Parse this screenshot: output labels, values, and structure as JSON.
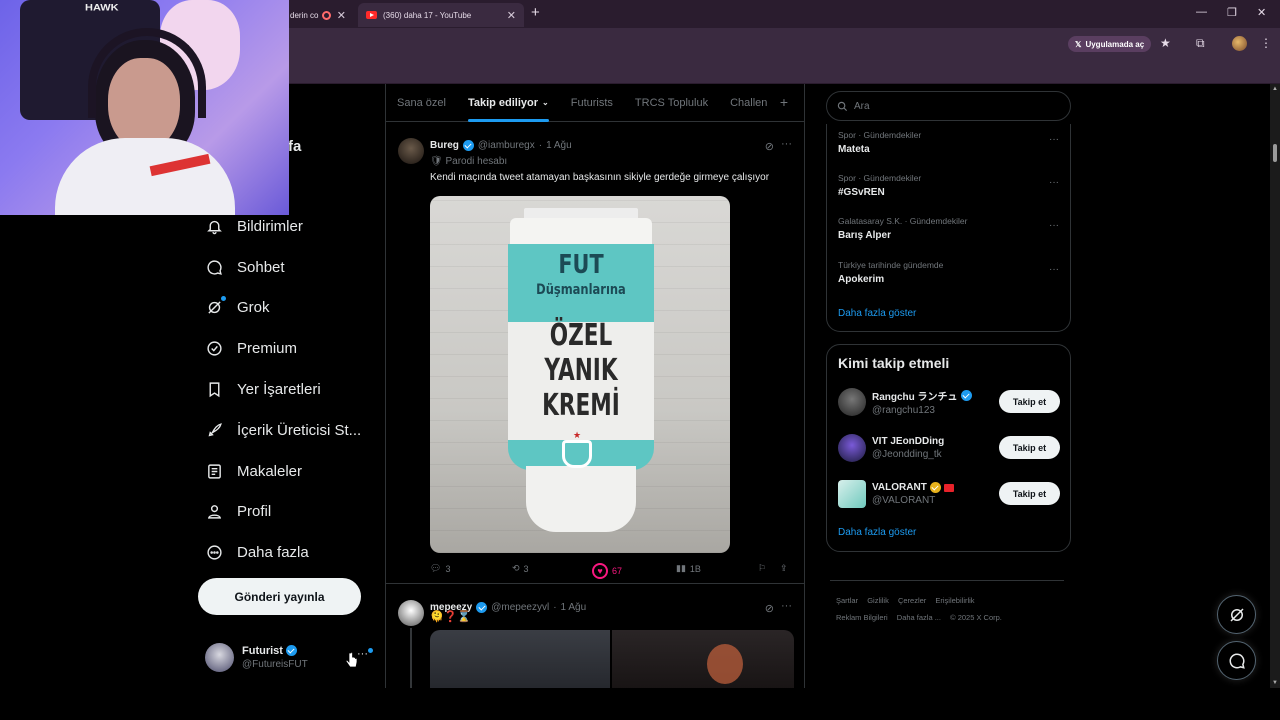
{
  "browser": {
    "tabs": [
      {
        "title": "derin co"
      },
      {
        "title": "(360) daha 17 - YouTube"
      }
    ],
    "open_in_app": "Uygulamada aç"
  },
  "webcam": {
    "chair_label": "HAWK"
  },
  "sidebar": {
    "partial_label": "fa",
    "items": [
      {
        "label": "Bildirimler",
        "icon": "bell-icon"
      },
      {
        "label": "Sohbet",
        "icon": "chat-icon"
      },
      {
        "label": "Grok",
        "icon": "grok-icon"
      },
      {
        "label": "Premium",
        "icon": "verified-circle-icon"
      },
      {
        "label": "Yer İşaretleri",
        "icon": "bookmark-icon"
      },
      {
        "label": "İçerik Üreticisi St...",
        "icon": "rocket-icon"
      },
      {
        "label": "Makaleler",
        "icon": "article-icon"
      },
      {
        "label": "Profil",
        "icon": "person-icon"
      },
      {
        "label": "Daha fazla",
        "icon": "more-circle-icon"
      }
    ],
    "post_button": "Gönderi yayınla",
    "account": {
      "name": "Futurist",
      "handle": "@FutureisFUT"
    }
  },
  "timeline": {
    "tabs": [
      {
        "label": "Sana özel"
      },
      {
        "label": "Takip ediliyor"
      },
      {
        "label": "Futurists"
      },
      {
        "label": "TRCS Topluluk"
      },
      {
        "label": "Challen"
      }
    ],
    "tweets": [
      {
        "name": "Bureg",
        "handle": "@iamburegx",
        "date": "1 Ağu",
        "parody": "Parodi hesabı",
        "text": "Kendi maçında tweet atamayan başkasının sikiyle gerdeğe girmeye çalışıyor",
        "media": {
          "line1": "FUT",
          "line2": "Düşmanlarına",
          "line3": "ÖZEL",
          "line4": "YANIK",
          "line5": "KREMİ"
        },
        "replies": "3",
        "reposts": "3",
        "likes": "67",
        "views": "1B"
      },
      {
        "name": "mepeezy",
        "handle": "@mepeezyvl",
        "date": "1 Ağu",
        "text": "🫠❓⌛"
      }
    ]
  },
  "right": {
    "search_placeholder": "Ara",
    "trends": [
      {
        "context": "Spor · Gündemdekiler",
        "name": "Mateta"
      },
      {
        "context": "Spor · Gündemdekiler",
        "name": "#GSvREN"
      },
      {
        "context": "Galatasaray S.K. · Gündemdekiler",
        "name": "Barış Alper"
      },
      {
        "context": "Türkiye tarihinde gündemde",
        "name": "Apokerim"
      }
    ],
    "show_more": "Daha fazla göster",
    "who_to_follow": {
      "title": "Kimi takip etmeli",
      "users": [
        {
          "name": "Rangchu ランチュ",
          "handle": "@rangchu123",
          "button": "Takip et"
        },
        {
          "name": "VIT JEonDDing",
          "handle": "@Jeondding_tk",
          "button": "Takip et"
        },
        {
          "name": "VALORANT",
          "handle": "@VALORANT",
          "button": "Takip et"
        }
      ],
      "show_more": "Daha fazla göster"
    },
    "footer": {
      "links": [
        "Şartlar",
        "Gizlilik",
        "Çerezler",
        "Erişilebilirlik",
        "Reklam Bilgileri",
        "Daha fazla ...",
        "© 2025 X Corp."
      ]
    }
  },
  "colors": {
    "accent": "#1d9bf0",
    "like": "#f91880",
    "background": "#000000"
  }
}
